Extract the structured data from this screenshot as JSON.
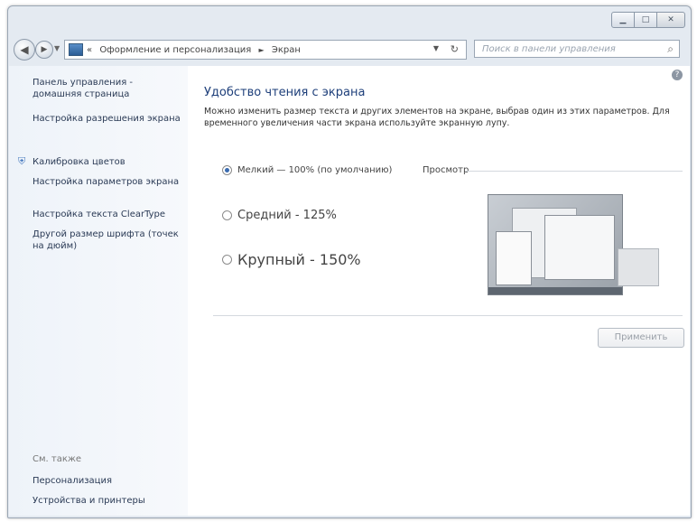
{
  "window": {
    "minimize_icon": "minimize-icon",
    "maximize_icon": "maximize-icon",
    "close_icon": "close-icon"
  },
  "address": {
    "prefix": "«",
    "crumb1": "Оформление и персонализация",
    "separator": "►",
    "crumb2": "Экран"
  },
  "search": {
    "placeholder": "Поиск в панели управления"
  },
  "sidebar": {
    "items": [
      {
        "label": "Панель управления - домашняя страница"
      },
      {
        "label": "Настройка разрешения экрана"
      },
      {
        "label": "Калибровка цветов"
      },
      {
        "label": "Настройка параметров экрана"
      },
      {
        "label": "Настройка текста ClearType"
      },
      {
        "label": "Другой размер шрифта (точек на дюйм)"
      }
    ],
    "see_also_title": "См. также",
    "see_also": [
      {
        "label": "Персонализация"
      },
      {
        "label": "Устройства и принтеры"
      }
    ]
  },
  "main": {
    "title": "Удобство чтения с экрана",
    "description": "Можно изменить размер текста и других элементов на экране, выбрав один из этих параметров. Для временного увеличения части экрана используйте экранную лупу.",
    "options": [
      {
        "label": "Мелкий — 100% (по умолчанию)",
        "selected": true
      },
      {
        "label": "Средний - 125%",
        "selected": false
      },
      {
        "label": "Крупный - 150%",
        "selected": false
      }
    ],
    "preview_label": "Просмотр",
    "apply_label": "Применить"
  }
}
